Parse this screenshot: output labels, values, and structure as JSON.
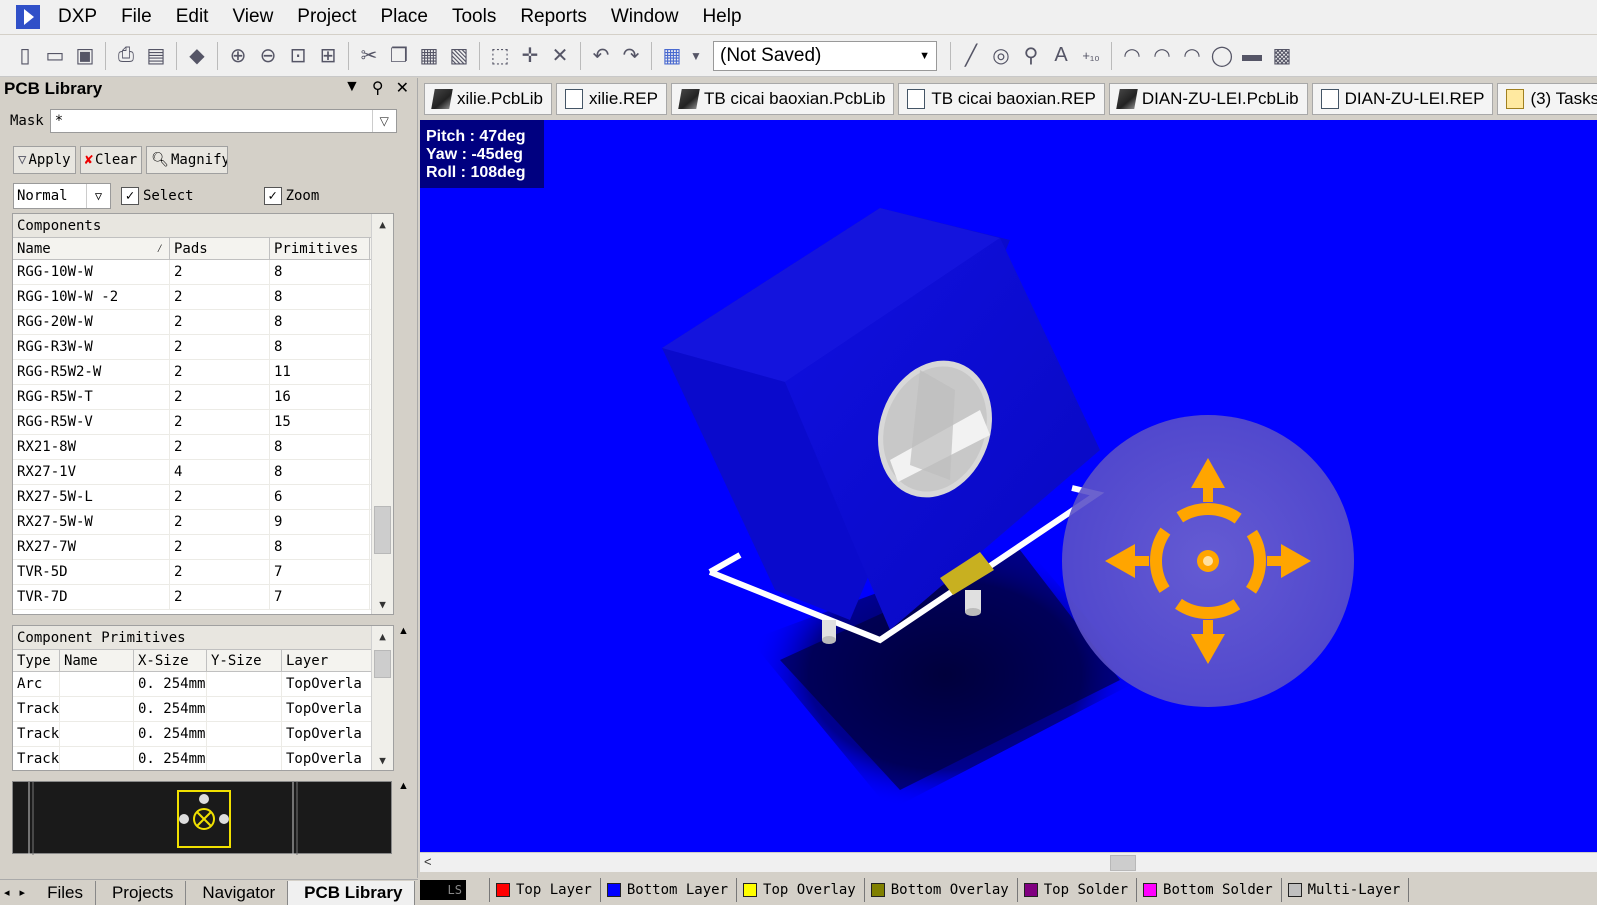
{
  "menu": {
    "items": [
      "DXP",
      "File",
      "Edit",
      "View",
      "Project",
      "Place",
      "Tools",
      "Reports",
      "Window",
      "Help"
    ]
  },
  "toolbar": {
    "project_combo": "(Not Saved)"
  },
  "panel": {
    "title": "PCB Library",
    "mask_label": "Mask",
    "mask_value": "*",
    "apply_label": "Apply",
    "clear_label": "Clear",
    "magnify_label": "Magnify",
    "mode_value": "Normal",
    "select_label": "Select",
    "zoom_label": "Zoom",
    "select_checked": true,
    "zoom_checked": true
  },
  "components": {
    "title": "Components",
    "columns": [
      "Name",
      "Pads",
      "Primitives"
    ],
    "rows": [
      [
        "RGG-10W-W",
        "2",
        "8"
      ],
      [
        "RGG-10W-W -2",
        "2",
        "8"
      ],
      [
        "RGG-20W-W",
        "2",
        "8"
      ],
      [
        "RGG-R3W-W",
        "2",
        "8"
      ],
      [
        "RGG-R5W2-W",
        "2",
        "11"
      ],
      [
        "RGG-R5W-T",
        "2",
        "16"
      ],
      [
        "RGG-R5W-V",
        "2",
        "15"
      ],
      [
        "RX21-8W",
        "2",
        "8"
      ],
      [
        "RX27-1V",
        "4",
        "8"
      ],
      [
        "RX27-5W-L",
        "2",
        "6"
      ],
      [
        "RX27-5W-W",
        "2",
        "9"
      ],
      [
        "RX27-7W",
        "2",
        "8"
      ],
      [
        "TVR-5D",
        "2",
        "7"
      ],
      [
        "TVR-7D",
        "2",
        "7"
      ]
    ]
  },
  "primitives": {
    "title": "Component Primitives",
    "columns": [
      "Type",
      "Name",
      "X-Size",
      "Y-Size",
      "Layer"
    ],
    "rows": [
      [
        "Arc",
        "",
        "0. 254mm",
        "",
        "TopOverla"
      ],
      [
        "Track",
        "",
        "0. 254mm",
        "",
        "TopOverla"
      ],
      [
        "Track",
        "",
        "0. 254mm",
        "",
        "TopOverla"
      ],
      [
        "Track",
        "",
        "0. 254mm",
        "",
        "TopOverla"
      ]
    ]
  },
  "panel_tabs": [
    "Files",
    "Projects",
    "Navigator",
    "PCB Library"
  ],
  "doc_tabs": [
    {
      "label": "xilie.PcbLib",
      "icon": "pcblib-icon"
    },
    {
      "label": "xilie.REP",
      "icon": "report-icon"
    },
    {
      "label": "TB cicai baoxian.PcbLib",
      "icon": "pcblib-icon"
    },
    {
      "label": "TB cicai baoxian.REP",
      "icon": "report-icon"
    },
    {
      "label": "DIAN-ZU-LEI.PcbLib",
      "icon": "pcblib-icon"
    },
    {
      "label": "DIAN-ZU-LEI.REP",
      "icon": "report-icon"
    },
    {
      "label": "(3) Tasks",
      "icon": "tasks-icon"
    }
  ],
  "view": {
    "pitch": "Pitch : 47deg",
    "yaw": "Yaw : -45deg",
    "roll": "Roll : 108deg",
    "background": "#0000ff"
  },
  "layers": [
    {
      "label": "LS",
      "color": "#000000"
    },
    {
      "label": "Top Layer",
      "color": "#ff0000"
    },
    {
      "label": "Bottom Layer",
      "color": "#0000ff"
    },
    {
      "label": "Top Overlay",
      "color": "#ffff00"
    },
    {
      "label": "Bottom Overlay",
      "color": "#808000"
    },
    {
      "label": "Top Solder",
      "color": "#800080"
    },
    {
      "label": "Bottom Solder",
      "color": "#ff00ff"
    },
    {
      "label": "Multi-Layer",
      "color": "#c0c0c0"
    }
  ]
}
